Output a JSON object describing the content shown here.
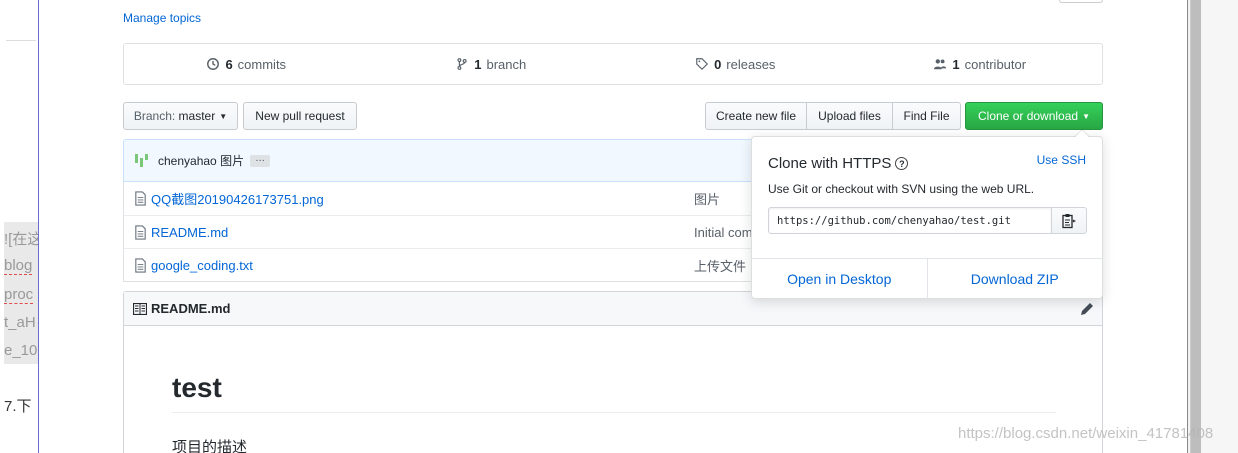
{
  "background_left": {
    "lines": [
      "![在这",
      "blog",
      "proc",
      "t_aH",
      "e_10",
      "7.下"
    ]
  },
  "repo": {
    "manage_topics": "Manage topics",
    "stats": {
      "commits_count": "6",
      "commits_label": "commits",
      "branches_count": "1",
      "branches_label": "branch",
      "releases_count": "0",
      "releases_label": "releases",
      "contributors_count": "1",
      "contributors_label": "contributor"
    },
    "toolbar": {
      "branch_prefix": "Branch:",
      "branch_name": "master",
      "new_pull_request": "New pull request",
      "create_new_file": "Create new file",
      "upload_files": "Upload files",
      "find_file": "Find File",
      "clone_or_download": "Clone or download"
    },
    "latest_commit": {
      "author": "chenyahao",
      "message": "图片",
      "ellipsis": "…"
    },
    "files": [
      {
        "name": "QQ截图20190426173751.png",
        "message": "图片"
      },
      {
        "name": "README.md",
        "message": "Initial com"
      },
      {
        "name": "google_coding.txt",
        "message": "上传文件"
      }
    ],
    "readme": {
      "header": "README.md",
      "title": "test",
      "body": "项目的描述"
    }
  },
  "clone_dropdown": {
    "title": "Clone with HTTPS",
    "use_ssh": "Use SSH",
    "description": "Use Git or checkout with SVN using the web URL.",
    "url": "https://github.com/chenyahao/test.git",
    "open_in_desktop": "Open in Desktop",
    "download_zip": "Download ZIP"
  },
  "watermark": "https://blog.csdn.net/weixin_41781408",
  "colors": {
    "link": "#0366d6",
    "green_button": "#28a745",
    "commit_bar": "#f1f8ff"
  }
}
